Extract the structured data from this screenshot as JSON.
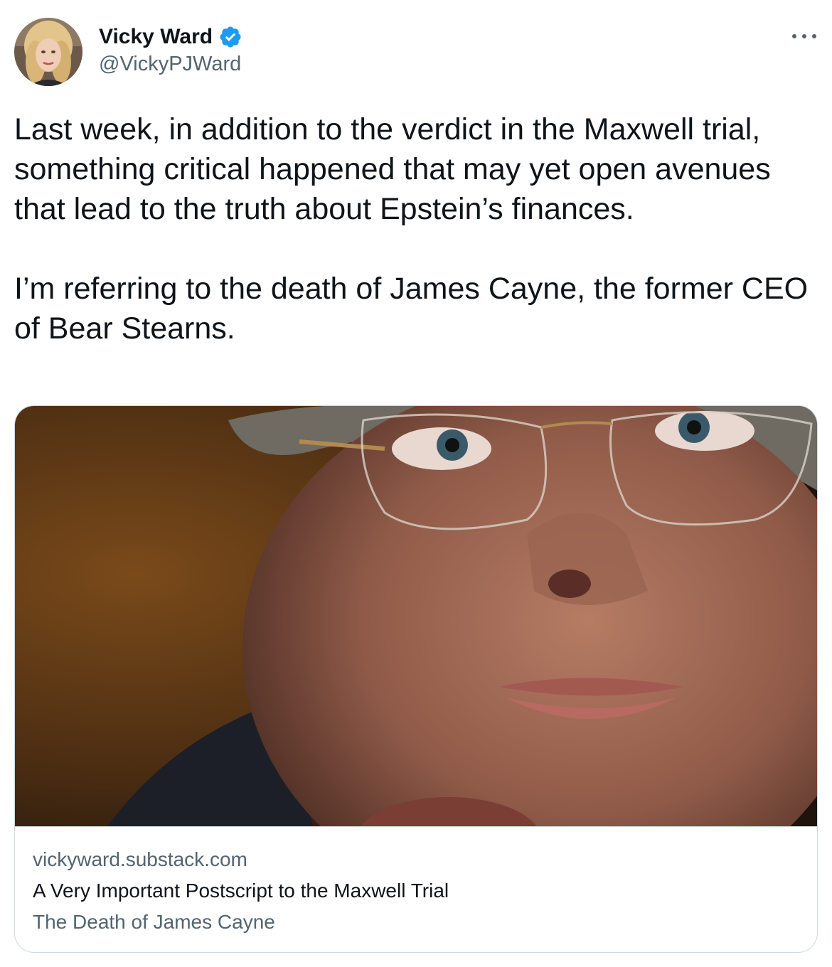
{
  "author": {
    "display_name": "Vicky Ward",
    "handle": "@VickyPJWard",
    "verified": true,
    "avatar_icon": "profile-photo-avatar"
  },
  "menu": {
    "more_icon": "ellipsis-icon"
  },
  "tweet": {
    "text": "Last week, in addition to the verdict in the Maxwell trial, something critical happened that may yet open avenues that lead to the truth about Epstein’s finances.\n\nI’m referring to the death of James Cayne, the former CEO of Bear Stearns."
  },
  "link_card": {
    "domain": "vickyward.substack.com",
    "title": "A Very Important Postscript to the Maxwell Trial",
    "description": "The Death of James Cayne"
  },
  "colors": {
    "text_primary": "#0f1419",
    "text_secondary": "#536471",
    "verified_blue": "#1d9bf0",
    "border": "#cfd9de"
  }
}
